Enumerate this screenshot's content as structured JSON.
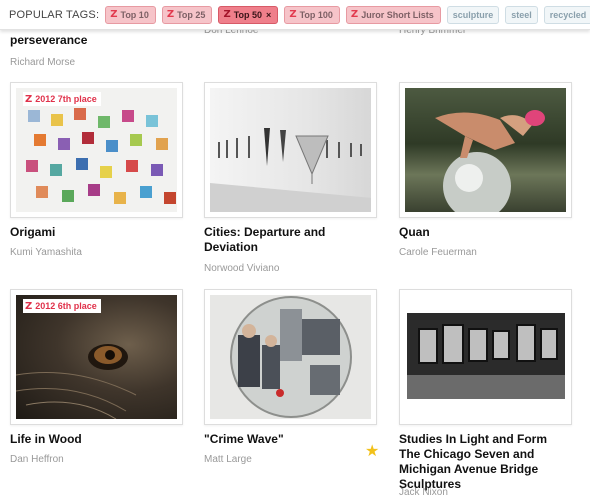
{
  "tagbar": {
    "label": "POPULAR TAGS:",
    "tags": [
      {
        "label": "Top 10",
        "kind": "top",
        "active": false
      },
      {
        "label": "Top 25",
        "kind": "top",
        "active": false
      },
      {
        "label": "Top 50",
        "kind": "top",
        "active": true
      },
      {
        "label": "Top 100",
        "kind": "top",
        "active": false
      },
      {
        "label": "Juror Short Lists",
        "kind": "top",
        "active": false
      },
      {
        "label": "sculpture",
        "kind": "plain",
        "active": false
      },
      {
        "label": "steel",
        "kind": "plain",
        "active": false
      },
      {
        "label": "recycled",
        "kind": "plain",
        "active": false
      }
    ],
    "remove_symbol": "×",
    "brand_mark": "Z"
  },
  "row0": {
    "items": [
      {
        "title": "perseverance",
        "artist": "Richard Morse"
      },
      {
        "title": "",
        "artist": "Don Lenhoe"
      },
      {
        "title": "",
        "artist": "Henry Brimmer"
      }
    ]
  },
  "cards": [
    {
      "title": "Origami",
      "artist": "Kumi Yamashita",
      "badge": "2012 7th place",
      "favorite": false
    },
    {
      "title": "Cities: Departure and Deviation",
      "artist": "Norwood Viviano",
      "badge": "",
      "favorite": false
    },
    {
      "title": "Quan",
      "artist": "Carole Feuerman",
      "badge": "",
      "favorite": false
    },
    {
      "title": "Life in Wood",
      "artist": "Dan Heffron",
      "badge": "2012 6th place",
      "favorite": false
    },
    {
      "title": "\"Crime Wave\"",
      "artist": "Matt Large",
      "badge": "",
      "favorite": true
    },
    {
      "title": "Studies In Light and Form The Chicago Seven and Michigan Avenue Bridge Sculptures",
      "artist": "Jack Nixon",
      "badge": "",
      "favorite": false
    }
  ],
  "icons": {
    "favorite": "star-icon",
    "badge": "ribbon-z-icon",
    "remove": "close-icon"
  },
  "colors": {
    "accent": "#e0314a",
    "tag_top_bg": "#f6c4c9",
    "tag_active_bg": "#ef7f8b",
    "tag_plain_bg": "#f1f6f8",
    "star": "#f2c11a"
  }
}
